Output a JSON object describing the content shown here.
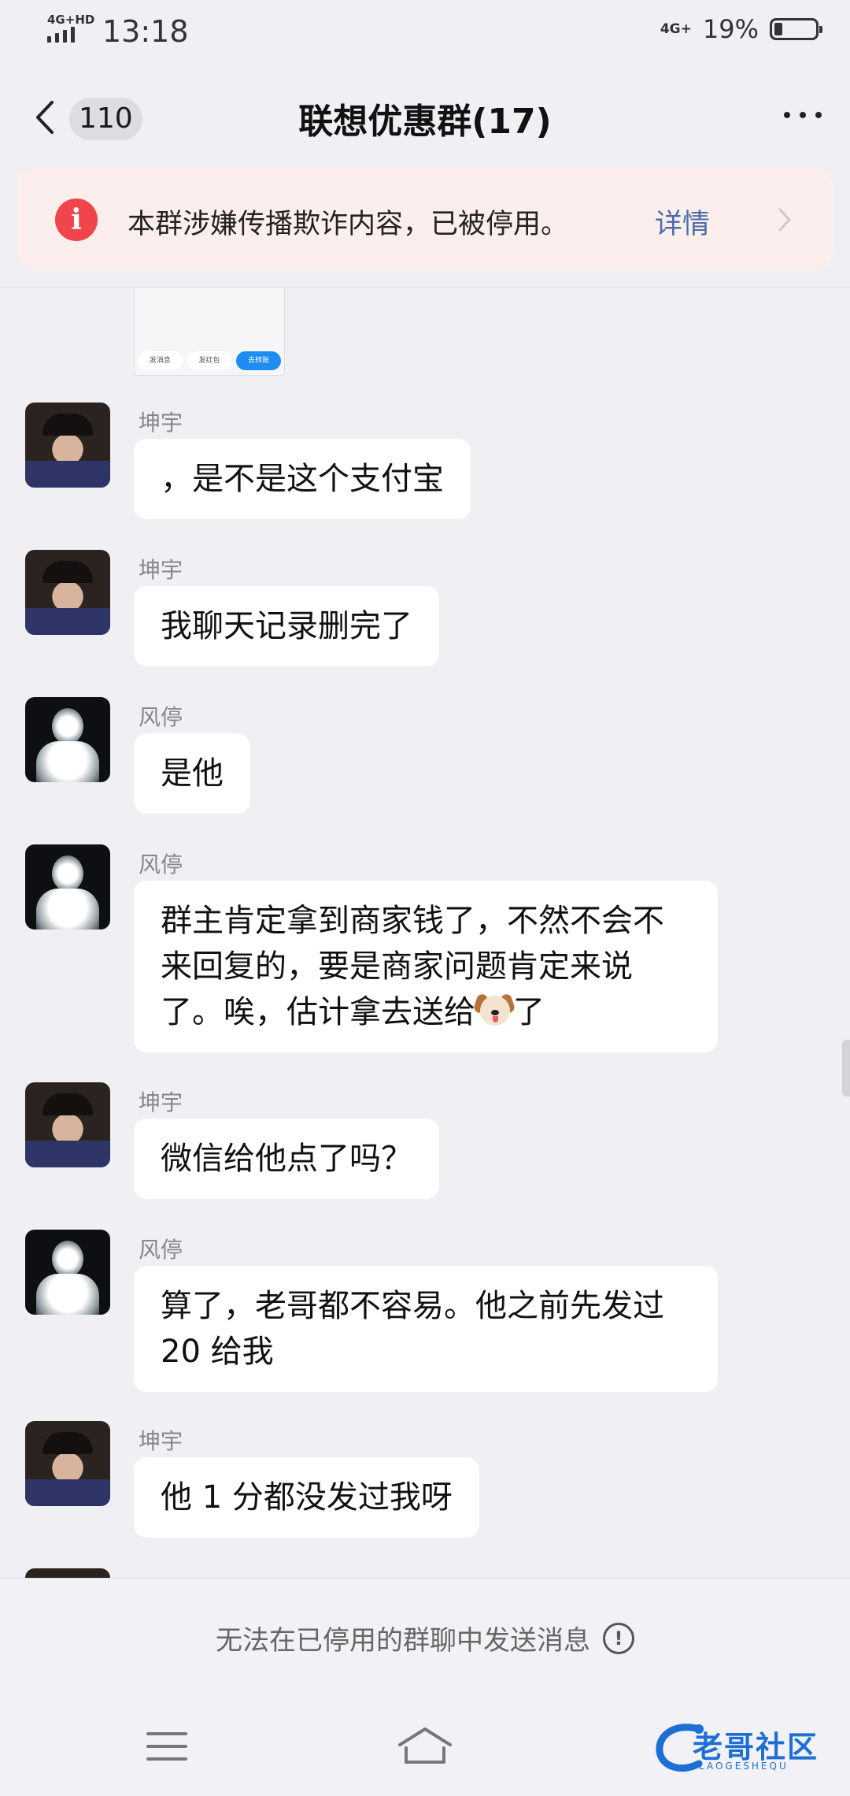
{
  "status_bar": {
    "network_left": "4G+HD",
    "time": "13:18",
    "network_right": "4G+",
    "battery_percent": "19%",
    "battery_level": 0.19
  },
  "header": {
    "unread_count": "110",
    "title": "联想优惠群(17)"
  },
  "banner": {
    "icon": "i",
    "text": "本群涉嫌传播欺诈内容，已被停用。",
    "link": "详情"
  },
  "partial_card": {
    "chips": [
      "发消息",
      "发红包",
      "去转账"
    ]
  },
  "messages": [
    {
      "sender": "坤宇",
      "avatar": "kid-avatar",
      "text": "，是不是这个支付宝"
    },
    {
      "sender": "坤宇",
      "avatar": "kid-avatar",
      "text": "我聊天记录删完了"
    },
    {
      "sender": "风停",
      "avatar": "ghost-avatar",
      "text": "是他"
    },
    {
      "sender": "风停",
      "avatar": "ghost-avatar",
      "text_before_emoji": "群主肯定拿到商家钱了，不然不会不来回复的，要是商家问题肯定来说了。唉，估计拿去送给",
      "emoji": "dog-face-emoji",
      "text_after_emoji": "了"
    },
    {
      "sender": "坤宇",
      "avatar": "kid-avatar",
      "text": "微信给他点了吗？"
    },
    {
      "sender": "风停",
      "avatar": "ghost-avatar",
      "text": "算了，老哥都不容易。他之前先发过 20 给我"
    },
    {
      "sender": "坤宇",
      "avatar": "kid-avatar",
      "text": "他 1 分都没发过我呀"
    }
  ],
  "footer": {
    "disabled_note": "无法在已停用的群聊中发送消息",
    "info_icon": "!"
  },
  "watermark": {
    "text": "老哥社区",
    "sub": "LAOGESHEQU"
  },
  "colors": {
    "accent_link": "#4a6da8",
    "warning_red": "#f0454a",
    "banner_bg": "#fdeeee",
    "watermark_blue": "#1d6fd6"
  }
}
